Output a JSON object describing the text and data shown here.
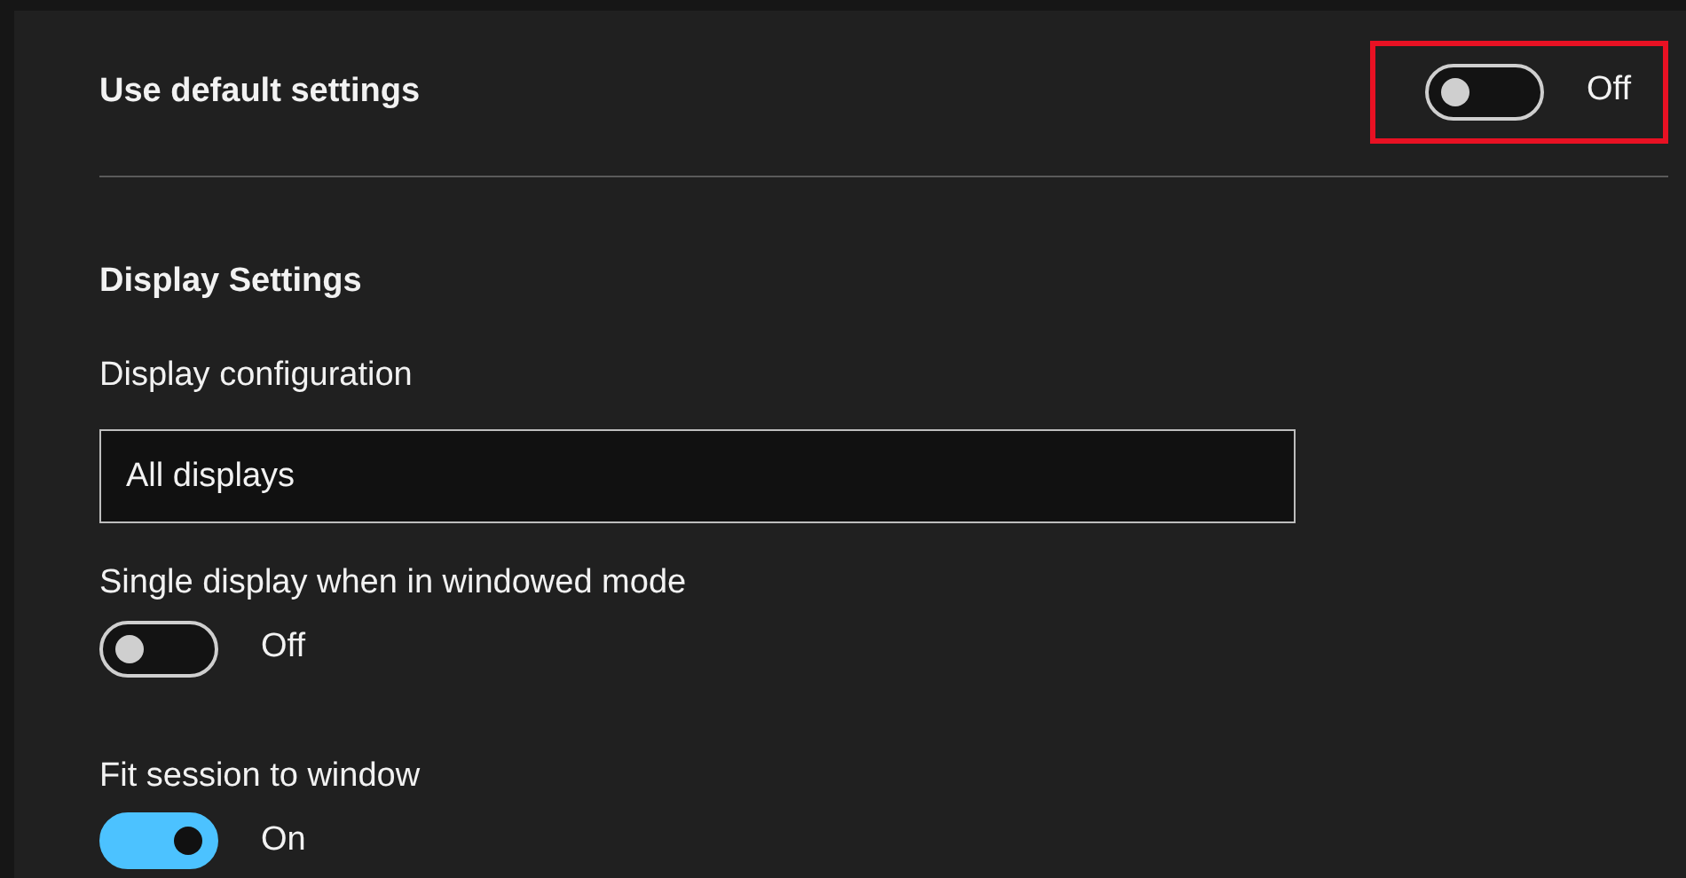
{
  "header": {
    "label": "Use default settings",
    "toggle": {
      "on": false,
      "state_text": "Off",
      "highlighted": true
    }
  },
  "section": {
    "title": "Display Settings",
    "field": {
      "label": "Display configuration",
      "value": "All displays"
    },
    "options": [
      {
        "label": "Single display when in windowed mode",
        "on": false,
        "state_text": "Off"
      },
      {
        "label": "Fit session to window",
        "on": true,
        "state_text": "On"
      }
    ]
  }
}
